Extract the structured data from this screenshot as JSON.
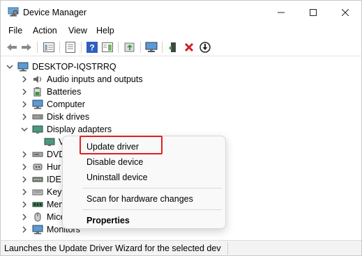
{
  "window": {
    "title": "Device Manager"
  },
  "menu": [
    "File",
    "Action",
    "View",
    "Help"
  ],
  "toolbar": {
    "buttons": [
      "back-arrow-icon",
      "forward-arrow-icon",
      "show-hide-tree-icon",
      "properties-icon",
      "help-icon",
      "action-pane-icon",
      "update-driver-icon",
      "monitor-icon",
      "add-driver-icon",
      "uninstall-x-icon",
      "download-arrow-icon"
    ]
  },
  "tree": {
    "root": "DESKTOP-IQSTRRQ",
    "items": [
      {
        "label": "Audio inputs and outputs",
        "icon": "speaker-icon"
      },
      {
        "label": "Batteries",
        "icon": "battery-icon"
      },
      {
        "label": "Computer",
        "icon": "computer-icon"
      },
      {
        "label": "Disk drives",
        "icon": "disk-icon"
      },
      {
        "label": "Display adapters",
        "icon": "display-icon",
        "expanded": true
      },
      {
        "label": "V",
        "icon": "display-icon",
        "child": true
      },
      {
        "label": "DVD",
        "icon": "dvd-icon"
      },
      {
        "label": "Hur",
        "icon": "hid-icon"
      },
      {
        "label": "IDE A",
        "icon": "ide-icon"
      },
      {
        "label": "Keyb",
        "icon": "keyboard-icon"
      },
      {
        "label": "Mem",
        "icon": "memory-icon"
      },
      {
        "label": "Mice",
        "icon": "mouse-icon"
      },
      {
        "label": "Monitors",
        "icon": "monitor-icon"
      }
    ]
  },
  "context_menu": {
    "update": "Update driver",
    "disable": "Disable device",
    "uninstall": "Uninstall device",
    "scan": "Scan for hardware changes",
    "properties": "Properties"
  },
  "status": {
    "text": "Launches the Update Driver Wizard for the selected dev"
  },
  "colors": {
    "highlight_border": "#e02020",
    "accent": "#0067c0"
  }
}
